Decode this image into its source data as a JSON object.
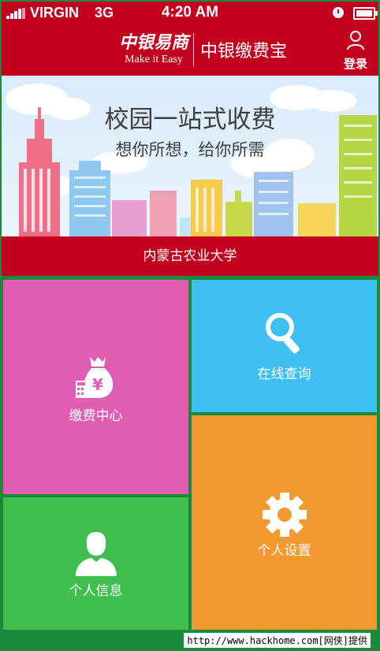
{
  "status_bar": {
    "carrier": "VIRGIN",
    "network": "3G",
    "time": "4:20 AM",
    "icons": [
      "signal-icon",
      "rotation-lock-icon",
      "battery-icon"
    ]
  },
  "header": {
    "logo_cn": "中银易商",
    "logo_en": "Make it Easy",
    "app_title": "中银缴费宝",
    "login_label": "登录",
    "background": "#c4001f"
  },
  "banner": {
    "title": "校园一站式收费",
    "subtitle": "想你所想，给你所需"
  },
  "school_name": "内蒙古农业大学",
  "tiles": [
    {
      "label": "缴费中心",
      "icon": "money-bag-icon",
      "color": "#e05db2"
    },
    {
      "label": "在线查询",
      "icon": "search-icon",
      "color": "#3ec0f5"
    },
    {
      "label": "个人设置",
      "icon": "gear-icon",
      "color": "#f29a2f"
    },
    {
      "label": "个人信息",
      "icon": "person-icon",
      "color": "#3fbd4d"
    }
  ],
  "footer": {
    "credit": "http://www.hackhome.com[网侠]提供"
  }
}
